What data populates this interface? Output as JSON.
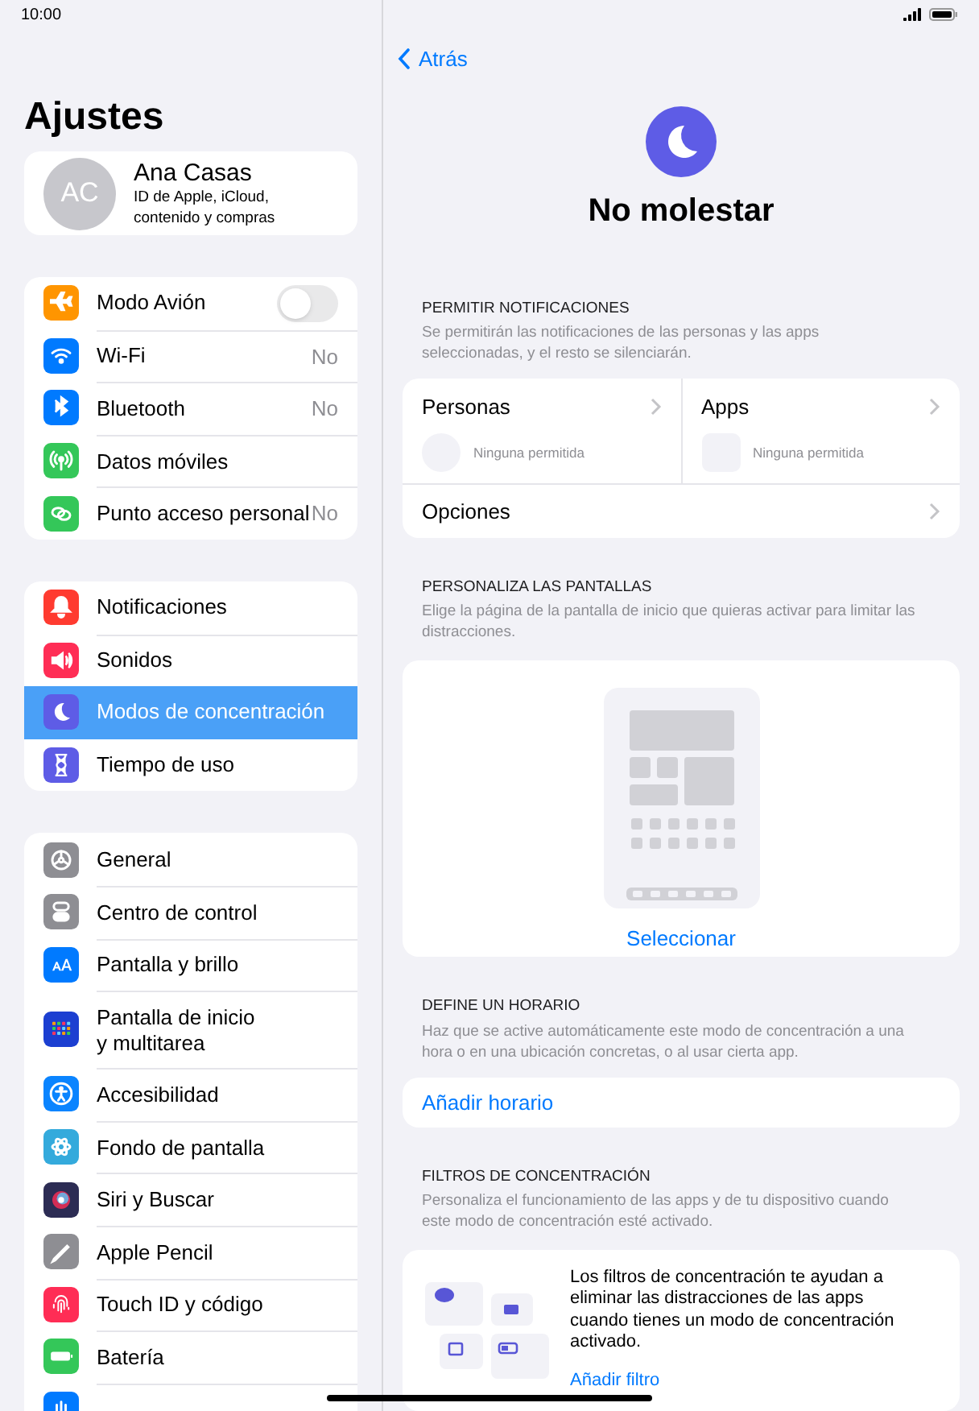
{
  "status_bar": {
    "time": "10:00"
  },
  "sidebar": {
    "title": "Ajustes",
    "profile": {
      "initials": "AC",
      "name": "Ana Casas",
      "subtitle": "ID de Apple, iCloud, contenido y compras"
    },
    "groups": [
      {
        "items": [
          {
            "label": "Modo Avión",
            "kind": "toggle",
            "on": false,
            "selected": false
          },
          {
            "label": "Wi-Fi",
            "kind": "value",
            "value": "No",
            "selected": false
          },
          {
            "label": "Bluetooth",
            "kind": "value",
            "value": "No",
            "selected": false
          },
          {
            "label": "Datos móviles",
            "kind": "plain",
            "selected": false
          },
          {
            "label": "Punto acceso personal",
            "kind": "value",
            "value": "No",
            "selected": false
          }
        ]
      },
      {
        "items": [
          {
            "label": "Notificaciones",
            "kind": "plain",
            "selected": false
          },
          {
            "label": "Sonidos",
            "kind": "plain",
            "selected": false
          },
          {
            "label": "Modos de concentración",
            "kind": "plain",
            "selected": true
          },
          {
            "label": "Tiempo de uso",
            "kind": "plain",
            "selected": false
          }
        ]
      },
      {
        "items": [
          {
            "label": "General",
            "kind": "plain",
            "selected": false
          },
          {
            "label": "Centro de control",
            "kind": "plain",
            "selected": false
          },
          {
            "label": "Pantalla y brillo",
            "kind": "plain",
            "selected": false
          },
          {
            "label": "Pantalla de inicio\ny multitarea",
            "kind": "plain",
            "selected": false
          },
          {
            "label": "Accesibilidad",
            "kind": "plain",
            "selected": false
          },
          {
            "label": "Fondo de pantalla",
            "kind": "plain",
            "selected": false
          },
          {
            "label": "Siri y Buscar",
            "kind": "plain",
            "selected": false
          },
          {
            "label": "Apple Pencil",
            "kind": "plain",
            "selected": false
          },
          {
            "label": "Touch ID y código",
            "kind": "plain",
            "selected": false
          },
          {
            "label": "Batería",
            "kind": "plain",
            "selected": false
          },
          {
            "kind": "plain",
            "selected": false
          }
        ]
      }
    ]
  },
  "detail": {
    "back": "Atrás",
    "title": "No molestar",
    "allow": {
      "header": "PERMITIR NOTIFICACIONES",
      "description": "Se permitirán las notificaciones de las personas y las apps seleccionadas, y el resto se silenciarán.",
      "columns": [
        {
          "label": "Personas",
          "status": "Ninguna permitida",
          "kind": "people"
        },
        {
          "label": "Apps",
          "status": "Ninguna permitida",
          "kind": "apps"
        }
      ],
      "options": "Opciones"
    },
    "screens": {
      "header": "PERSONALIZA LAS PANTALLAS",
      "description": "Elige la página de la pantalla de inicio que quieras activar para limitar las distracciones.",
      "action": "Seleccionar"
    },
    "schedule": {
      "header": "DEFINE UN HORARIO",
      "description": "Haz que se active automáticamente este modo de concentración a una hora o en una ubicación concretas, o al usar cierta app.",
      "action": "Añadir horario"
    },
    "filters": {
      "header": "FILTROS DE CONCENTRACIÓN",
      "description": "Personaliza el funcionamiento de las apps y de tu dispositivo cuando este modo de concentración esté activado.",
      "text": "Los filtros de concentración te ayudan a eliminar las distracciones de las apps cuando tienes un modo de concentración activado.",
      "action": "Añadir filtro"
    }
  }
}
